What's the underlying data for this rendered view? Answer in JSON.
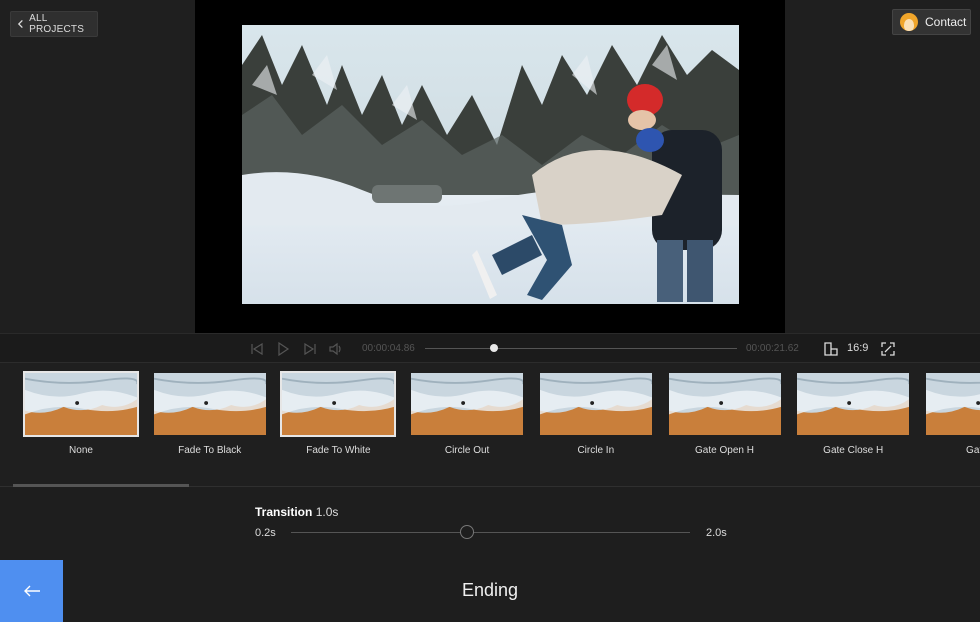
{
  "header": {
    "back_label": "ALL PROJECTS",
    "contact_label": "Contact"
  },
  "player": {
    "current_time": "00:00:04.86",
    "total_time": "00:00:21.62",
    "progress": 0.22,
    "aspect_ratio": "16:9"
  },
  "transitions": {
    "items": [
      {
        "label": "None",
        "selected": true
      },
      {
        "label": "Fade To Black",
        "selected": false
      },
      {
        "label": "Fade To White",
        "selected": true
      },
      {
        "label": "Circle Out",
        "selected": false
      },
      {
        "label": "Circle In",
        "selected": false
      },
      {
        "label": "Gate Open H",
        "selected": false
      },
      {
        "label": "Gate Close H",
        "selected": false
      },
      {
        "label": "Gate C",
        "selected": false
      }
    ]
  },
  "settings": {
    "title": "Transition",
    "value": "1.0s",
    "min": "0.2s",
    "max": "2.0s",
    "level": 0.44
  },
  "footer": {
    "section_title": "Ending"
  },
  "colors": {
    "accent": "#4f8ff0",
    "background": "#1e1e1e"
  }
}
